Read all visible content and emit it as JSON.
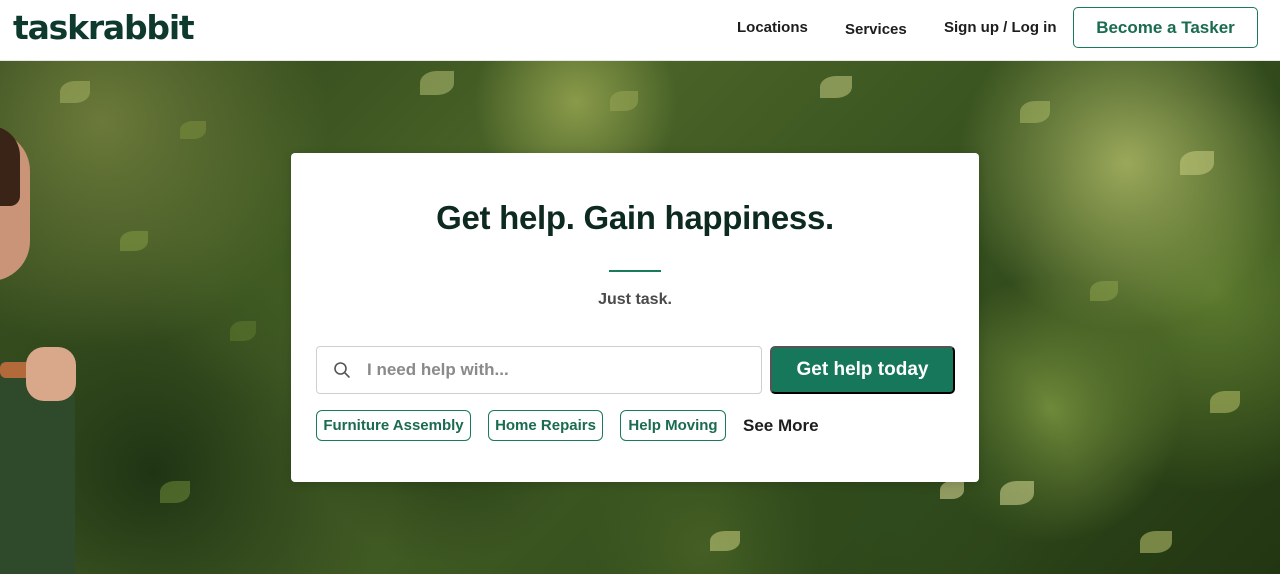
{
  "header": {
    "logo_text": "taskrabbit",
    "nav": {
      "locations": "Locations",
      "services": "Services",
      "signup_login": "Sign up / Log in"
    },
    "become_tasker": "Become a Tasker"
  },
  "hero": {
    "headline": "Get help. Gain happiness.",
    "subtitle": "Just task.",
    "search": {
      "placeholder": "I need help with...",
      "value": "",
      "icon": "search-icon"
    },
    "cta_label": "Get help today",
    "chips": [
      "Furniture Assembly",
      "Home Repairs",
      "Help Moving"
    ],
    "see_more": "See More"
  },
  "colors": {
    "brand_dark": "#0d3a2c",
    "brand_green": "#17775a",
    "chip_border": "#1a7a5c"
  }
}
